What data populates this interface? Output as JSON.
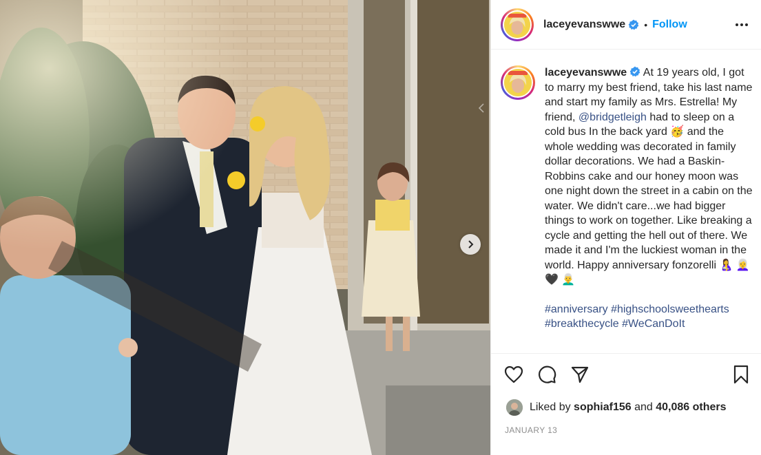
{
  "post": {
    "username": "laceyevanswwe",
    "follow_label": "Follow",
    "separator": "•",
    "caption": {
      "part1": "At 19 years old, I got to marry my best friend, take his last name and start my family as Mrs. Estrella! My friend, ",
      "mention": "@bridgetleigh",
      "part2": " had to sleep on a cold bus In the back yard 🥳 and the whole wedding was decorated in family dollar decorations. We had a Baskin-Robbins cake and our honey moon was one night down the street in a cabin on the water. We didn't care...we had bigger things to work on together. Like breaking a cycle and getting the hell out of there. We made it and I'm the luckiest woman in the world. Happy anniversary fonzorelli 🤱 👩‍🦳 🖤 👨‍🦳"
    },
    "hashtags": [
      "#anniversary",
      "#highschoolsweethearts",
      "#breakthecycle",
      "#WeCanDoIt"
    ],
    "likes": {
      "prefix": "Liked by",
      "liker": "sophiaf156",
      "and": "and",
      "others": "40,086 others"
    },
    "date": "JANUARY 13"
  },
  "icons": {
    "verified": "verified-badge-icon",
    "more": "more-options-icon",
    "like": "heart-icon",
    "comment": "comment-icon",
    "share": "share-icon",
    "save": "bookmark-icon",
    "next": "chevron-right-icon"
  },
  "colors": {
    "accent": "#0095f6",
    "link": "#385185",
    "text": "#262626",
    "muted": "#8e8e8e"
  }
}
